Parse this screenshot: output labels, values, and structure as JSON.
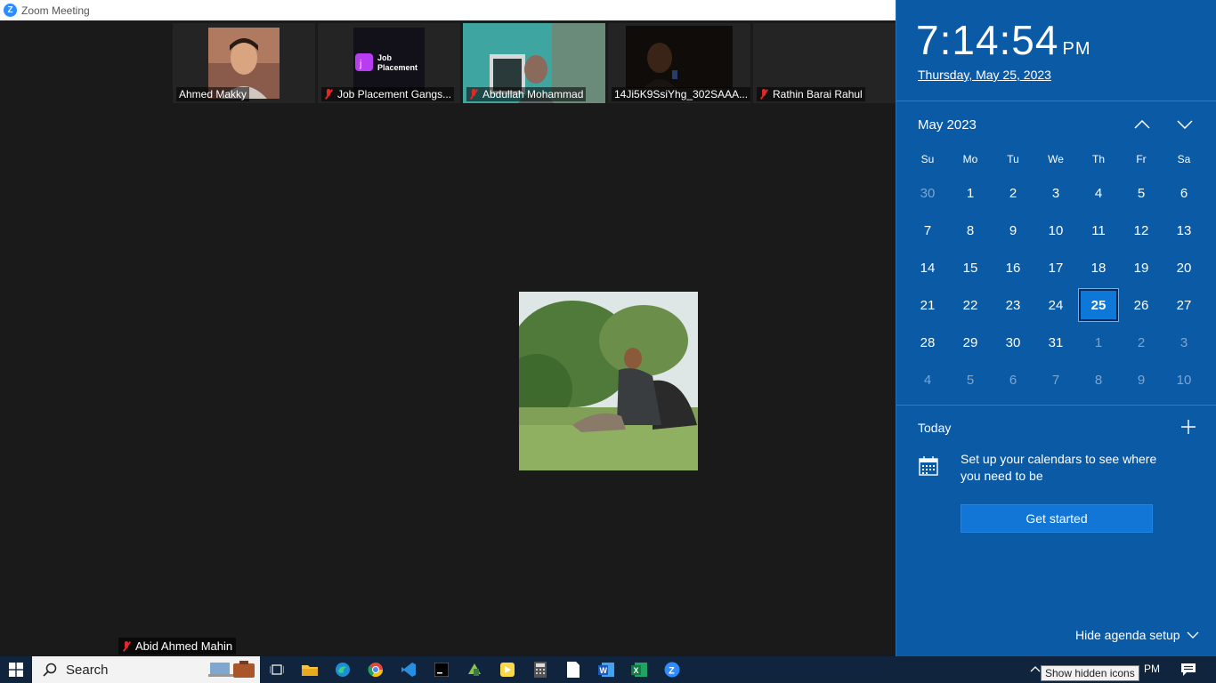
{
  "window": {
    "title": "Zoom Meeting"
  },
  "participants": [
    {
      "name": "Ahmed Makky",
      "muted": false
    },
    {
      "name": "Job Placement Gangs...",
      "muted": true,
      "logo_text": "Job Placement"
    },
    {
      "name": "Abdullah Mohammad",
      "muted": true
    },
    {
      "name": "14Ji5K9SsiYhg_302SAAA...",
      "muted": false
    },
    {
      "name": "Rathin Barai Rahul",
      "muted": true
    }
  ],
  "active_speaker": {
    "name": "Abid Ahmed Mahin",
    "muted": true
  },
  "calendar": {
    "time": "7:14:54",
    "ampm": "PM",
    "date_long": "Thursday, May 25, 2023",
    "month_label": "May 2023",
    "weekdays": [
      "Su",
      "Mo",
      "Tu",
      "We",
      "Th",
      "Fr",
      "Sa"
    ],
    "weeks": [
      [
        "30",
        "1",
        "2",
        "3",
        "4",
        "5",
        "6"
      ],
      [
        "7",
        "8",
        "9",
        "10",
        "11",
        "12",
        "13"
      ],
      [
        "14",
        "15",
        "16",
        "17",
        "18",
        "19",
        "20"
      ],
      [
        "21",
        "22",
        "23",
        "24",
        "25",
        "26",
        "27"
      ],
      [
        "28",
        "29",
        "30",
        "31",
        "1",
        "2",
        "3"
      ],
      [
        "4",
        "5",
        "6",
        "7",
        "8",
        "9",
        "10"
      ]
    ],
    "today": "25",
    "accent": "#0b5aa6"
  },
  "agenda": {
    "today_label": "Today",
    "setup_text": "Set up your calendars to see where you need to be",
    "get_started_label": "Get started",
    "hide_label": "Hide agenda setup"
  },
  "taskbar": {
    "search_label": "Search",
    "tooltip": "Show hidden icons",
    "clock": "PM",
    "apps": [
      "task-view-icon",
      "file-explorer-icon",
      "edge-icon",
      "chrome-icon",
      "vscode-icon",
      "intellij-icon",
      "app-icon",
      "sticky-icon",
      "calculator-icon",
      "notepad-icon",
      "word-icon",
      "excel-icon",
      "zoom-icon"
    ]
  }
}
